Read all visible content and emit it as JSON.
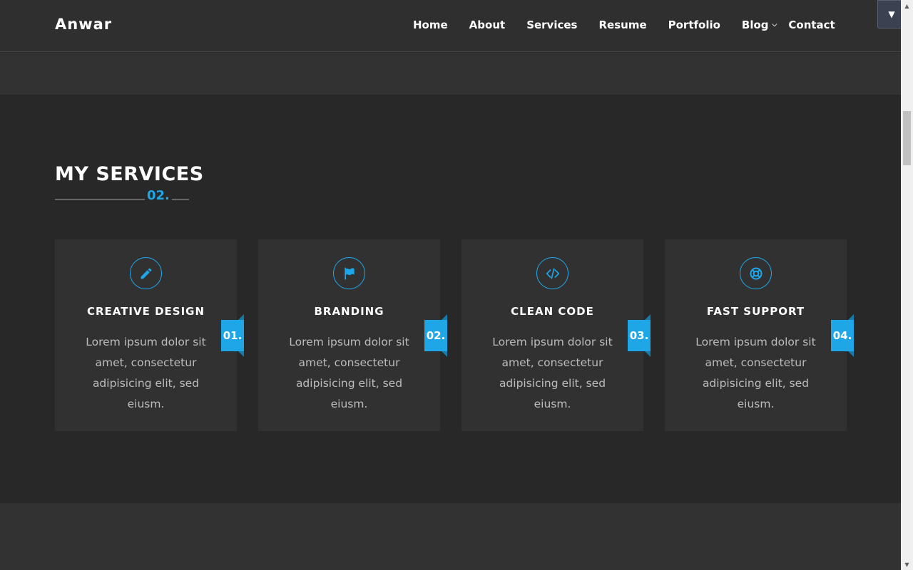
{
  "header": {
    "brand": "Anwar",
    "nav": [
      {
        "label": "Home"
      },
      {
        "label": "About"
      },
      {
        "label": "Services"
      },
      {
        "label": "Resume"
      },
      {
        "label": "Portfolio"
      },
      {
        "label": "Blog"
      },
      {
        "label": "Contact"
      }
    ]
  },
  "services": {
    "title": "MY SERVICES",
    "number": "02.",
    "cards": [
      {
        "icon": "pencil-icon",
        "title": "CREATIVE DESIGN",
        "text": "Lorem ipsum dolor sit amet, consectetur adipisicing elit, sed eiusm.",
        "badge": "01."
      },
      {
        "icon": "flag-icon",
        "title": "BRANDING",
        "text": "Lorem ipsum dolor sit amet, consectetur adipisicing elit, sed eiusm.",
        "badge": "02."
      },
      {
        "icon": "code-icon",
        "title": "CLEAN CODE",
        "text": "Lorem ipsum dolor sit amet, consectetur adipisicing elit, sed eiusm.",
        "badge": "03."
      },
      {
        "icon": "lifebuoy-icon",
        "title": "FAST SUPPORT",
        "text": "Lorem ipsum dolor sit amet, consectetur adipisicing elit, sed eiusm.",
        "badge": "04."
      }
    ]
  },
  "colors": {
    "accent": "#1fa6e6",
    "background": "#282828",
    "card": "#313131",
    "header": "#2f2f2f"
  }
}
